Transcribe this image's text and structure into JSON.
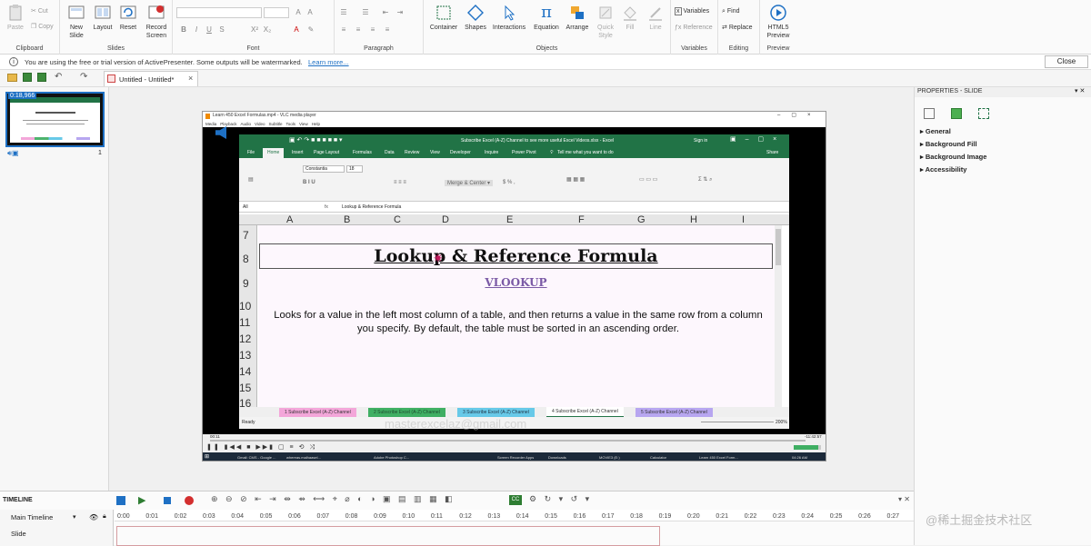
{
  "ribbon": {
    "clipboard": {
      "paste": "Paste",
      "cut": "Cut",
      "copy": "Copy",
      "label": "Clipboard"
    },
    "slides": {
      "new_slide": "New",
      "new_slide2": "Slide",
      "layout": "Layout",
      "reset": "Reset",
      "record": "Record",
      "record2": "Screen",
      "label": "Slides"
    },
    "font": {
      "label": "Font"
    },
    "paragraph": {
      "label": "Paragraph"
    },
    "objects": {
      "container": "Container",
      "shapes": "Shapes",
      "interactions": "Interactions",
      "equation": "Equation",
      "arrange": "Arrange",
      "quick": "Quick",
      "quick2": "Style",
      "fill": "Fill",
      "line": "Line",
      "label": "Objects"
    },
    "variables": {
      "variables": "Variables",
      "reference": "Reference",
      "label": "Variables"
    },
    "editing": {
      "find": "Find",
      "replace": "Replace",
      "label": "Editing"
    },
    "preview": {
      "html5": "HTML5",
      "preview": "Preview",
      "label": "Preview"
    }
  },
  "infobar": {
    "message": "You are using the free or trial version of ActivePresenter. Some outputs will be watermarked.",
    "link": "Learn more...",
    "close": "Close"
  },
  "tab": {
    "title": "Untitled - Untitled*"
  },
  "slide_panel": {
    "duration": "0:18,966",
    "index": "1"
  },
  "properties": {
    "title": "PROPERTIES - SLIDE",
    "sections": [
      "General",
      "Background Fill",
      "Background Image",
      "Accessibility"
    ]
  },
  "video": {
    "vlc_title": "Learn 450 Excel Formulas.mp4 - VLC media player",
    "vlc_menu": [
      "Media",
      "Playback",
      "Audio",
      "Video",
      "Subtitle",
      "Tools",
      "View",
      "Help"
    ],
    "excel_title": "Subscribe Excel (A-Z) Channel to see more useful Excel Videos.xlsx - Excel",
    "sign_in": "Sign in",
    "share": "Share",
    "excel_tabs": [
      "File",
      "Home",
      "Insert",
      "Page Layout",
      "Formulas",
      "Data",
      "Review",
      "View",
      "Developer",
      "Inquire",
      "Power Pivot"
    ],
    "tell_me": "Tell me what you want to do",
    "font_name": "Constantia",
    "font_size": "18",
    "name_box": "All",
    "formula": "Lookup & Reference Formula",
    "columns": [
      "A",
      "B",
      "C",
      "D",
      "E",
      "F",
      "G",
      "H",
      "I"
    ],
    "rows": [
      "7",
      "8",
      "9",
      "10",
      "11",
      "12",
      "13",
      "14",
      "15",
      "16"
    ],
    "heading": "Lookup & Reference Formula",
    "subheading": "VLOOKUP",
    "description": "Looks for a value in the left most column of a table, and then returns a value in the same row from a column you specify. By default, the table must be sorted in an ascending order.",
    "sheet_tabs": [
      "1 Subscribe Excel (A-Z) Channel",
      "2 Subscribe Excel (A-Z) Channel",
      "3 Subscribe Excel (A-Z) Channel",
      "4 Subscribe Excel (A-Z) Channel",
      "5 Subscribe Excel (A-Z) Channel"
    ],
    "watermark": "masterexcelaz@gmail.com",
    "status": "Ready",
    "zoom": "200%",
    "time_left": "00:11",
    "time_right": "-11:42:57",
    "taskbar": [
      "Gmail: CMS - Google ...",
      "whereas.malhaasel...",
      "Adobe Photoshop C...",
      "Screen Recorder Apps",
      "Downloads",
      "MOVIE3 (E:)",
      "Calculator",
      "Learn 450 Excel Form..."
    ],
    "clock": "04:26 AM"
  },
  "timeline": {
    "title": "TIMELINE",
    "main": "Main Timeline",
    "row_slide": "Slide",
    "ticks": [
      "0:00",
      "0:01",
      "0:02",
      "0:03",
      "0:04",
      "0:05",
      "0:06",
      "0:07",
      "0:08",
      "0:09",
      "0:10",
      "0:11",
      "0:12",
      "0:13",
      "0:14",
      "0:15",
      "0:16",
      "0:17",
      "0:18",
      "0:19",
      "0:20",
      "0:21",
      "0:22",
      "0:23",
      "0:24",
      "0:25",
      "0:26",
      "0:27"
    ]
  },
  "colors": {
    "accent": "#1e70c4",
    "excel_green": "#217346",
    "watermark_text": "#b9b9b9"
  }
}
